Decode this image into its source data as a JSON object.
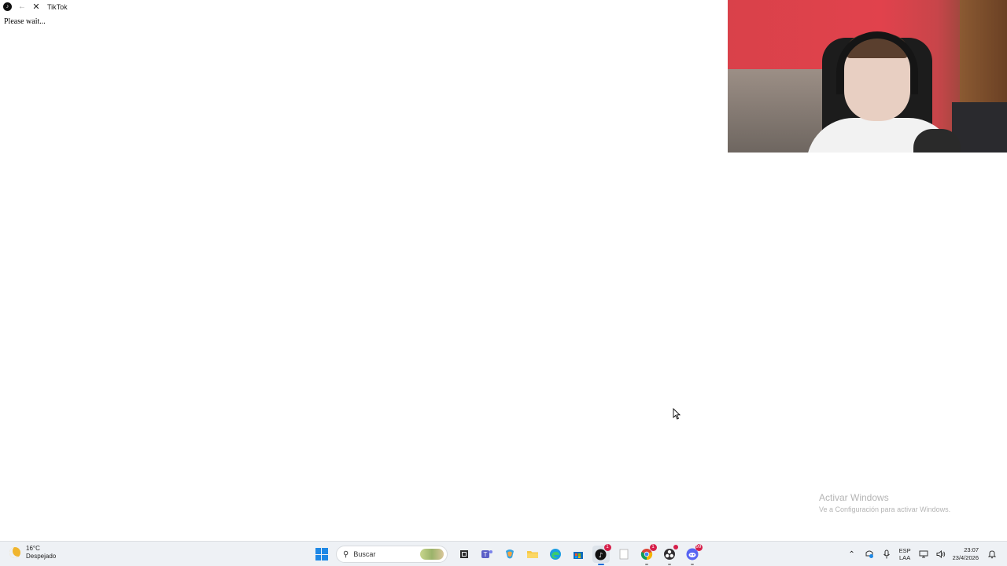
{
  "window": {
    "app_icon": "tiktok-logo-icon",
    "title": "TikTok"
  },
  "page": {
    "status_text": "Please wait..."
  },
  "watermark": {
    "title": "Activar Windows",
    "subtitle": "Ve a Configuración para activar Windows."
  },
  "taskbar": {
    "weather": {
      "temp": "16°C",
      "condition": "Despejado"
    },
    "search": {
      "placeholder": "Buscar"
    },
    "apps": [
      {
        "name": "task-view-icon"
      },
      {
        "name": "teams-icon"
      },
      {
        "name": "copilot-icon"
      },
      {
        "name": "file-explorer-icon"
      },
      {
        "name": "edge-icon"
      },
      {
        "name": "store-icon"
      },
      {
        "name": "tiktok-icon",
        "badge": "1",
        "active": true
      },
      {
        "name": "notepad-icon"
      },
      {
        "name": "chrome-icon",
        "badge": "1"
      },
      {
        "name": "obs-icon"
      },
      {
        "name": "discord-icon",
        "badge": "99"
      }
    ],
    "tray": {
      "language_line1": "ESP",
      "language_line2": "LAA",
      "time": "23:07",
      "date": "23/4/2026"
    }
  },
  "colors": {
    "taskbar_bg": "#eef1f5",
    "accent": "#1e88e5",
    "badge": "#d6204b",
    "webcam_wall": "#e1424c"
  }
}
